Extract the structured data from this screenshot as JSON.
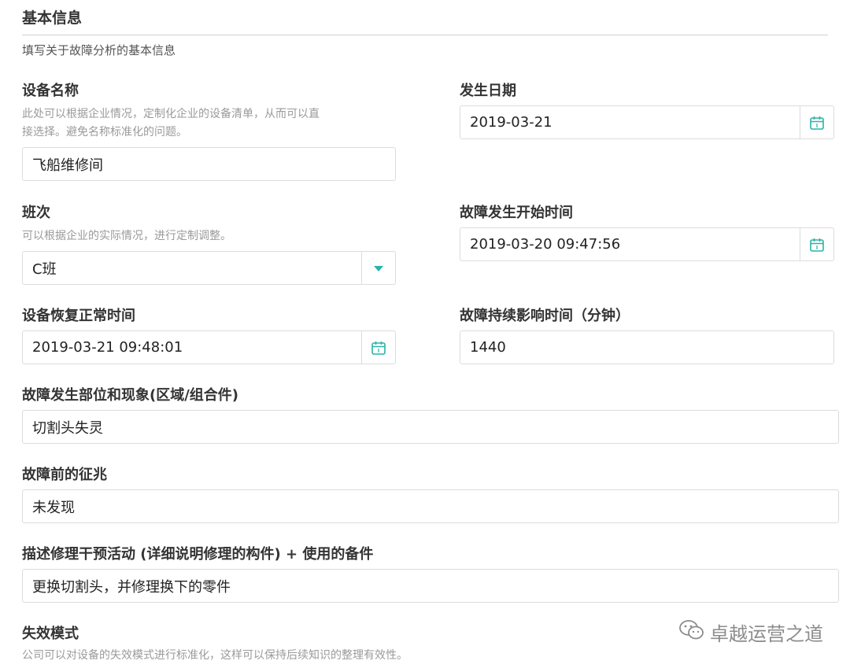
{
  "section": {
    "title": "基本信息",
    "description": "填写关于故障分析的基本信息"
  },
  "fields": {
    "equipment_name": {
      "label": "设备名称",
      "help_line1": "此处可以根据企业情况，定制化企业的设备清单，从而可以直",
      "help_line2": "接选择。避免名称标准化的问题。",
      "value": "飞船维修间"
    },
    "occurrence_date": {
      "label": "发生日期",
      "value": "2019-03-21",
      "icon": "calendar-icon"
    },
    "shift": {
      "label": "班次",
      "help": "可以根据企业的实际情况，进行定制调整。",
      "value": "C班",
      "icon": "caret-down-icon"
    },
    "fault_start_time": {
      "label": "故障发生开始时间",
      "value": "2019-03-20 09:47:56",
      "icon": "calendar-icon"
    },
    "recovery_time": {
      "label": "设备恢复正常时间",
      "value": "2019-03-21 09:48:01",
      "icon": "calendar-icon"
    },
    "impact_duration": {
      "label": "故障持续影响时间（分钟）",
      "value": "1440"
    },
    "fault_location": {
      "label": "故障发生部位和现象(区域/组合件)",
      "value": "切割头失灵"
    },
    "fault_signs": {
      "label": "故障前的征兆",
      "value": "未发现"
    },
    "repair_activity": {
      "label": "描述修理干预活动 (详细说明修理的构件) + 使用的备件",
      "value": "更换切割头，并修理换下的零件"
    },
    "failure_mode": {
      "label": "失效模式",
      "help": "公司可以对设备的失效模式进行标准化，这样可以保持后续知识的整理有效性。"
    }
  },
  "watermark": {
    "text": "卓越运营之道",
    "icon": "wechat-icon"
  },
  "colors": {
    "accent": "#2ab3a6",
    "border": "#dcdcdc",
    "help_text": "#9a9a9a",
    "label_text": "#333333"
  }
}
